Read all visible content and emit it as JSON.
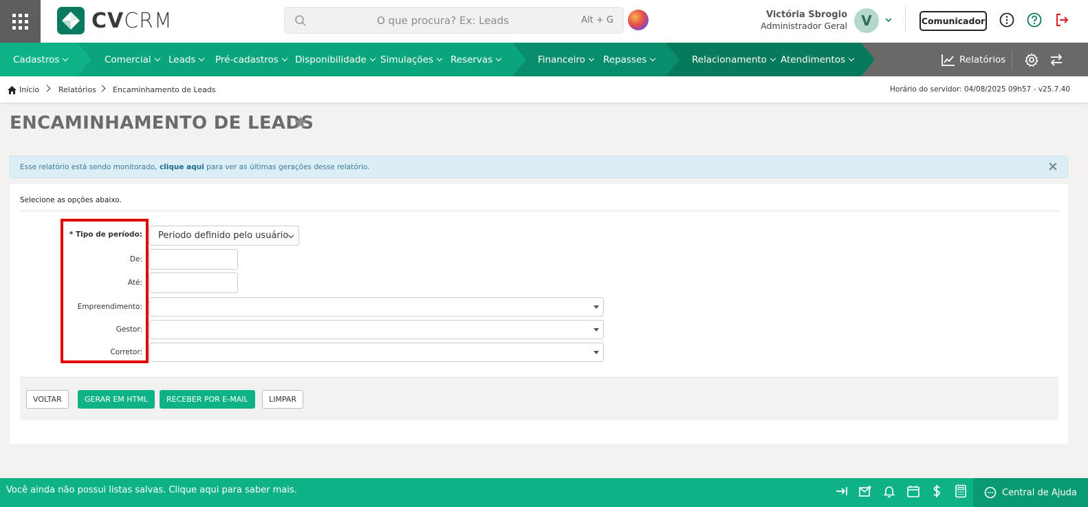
{
  "app": {
    "logo_text_bold": "CV",
    "logo_text_light": "CRM",
    "search_placeholder": "O que procura? Ex: Leads",
    "search_shortcut": "Alt + G"
  },
  "user": {
    "name": "Victória Sbrogio",
    "role": "Administrador Geral",
    "initial": "V"
  },
  "header": {
    "comunicador_label": "Comunicador"
  },
  "nav": {
    "items": [
      {
        "label": "Cadastros"
      },
      {
        "label": "Comercial"
      },
      {
        "label": "Leads"
      },
      {
        "label": "Pré-cadastros"
      },
      {
        "label": "Disponibilidade"
      },
      {
        "label": "Simulações"
      },
      {
        "label": "Reservas"
      },
      {
        "label": "Financeiro"
      },
      {
        "label": "Repasses"
      },
      {
        "label": "Relacionamento"
      },
      {
        "label": "Atendimentos"
      }
    ],
    "reports_label": "Relatórios"
  },
  "breadcrumb": {
    "home": "Início",
    "reports": "Relatórios",
    "current": "Encaminhamento de Leads",
    "server_time": "Horário do servidor: 04/08/2025 09h57 - v25.7.40"
  },
  "page": {
    "title": "ENCAMINHAMENTO DE LEADS"
  },
  "alert": {
    "text_before": "Esse relatório está sendo monitorado,",
    "link": "clique aqui",
    "text_after": "para ver as últimas gerações desse relatório."
  },
  "form": {
    "hint": "Selecione as opções abaixo.",
    "tipo_periodo_label": "* Tipo de período:",
    "tipo_periodo_value": "Periodo definido pelo usuário",
    "de_label": "De:",
    "ate_label": "Até:",
    "empreendimento_label": "Empreendimento:",
    "gestor_label": "Gestor:",
    "corretor_label": "Corretor:"
  },
  "actions": {
    "voltar": "VOLTAR",
    "gerar_html": "GERAR EM HTML",
    "receber_email": "RECEBER POR E-MAIL",
    "limpar": "LIMPAR"
  },
  "footer": {
    "text": "Você ainda não possui listas salvas. Clique aqui para saber mais.",
    "help_label": "Central de Ajuda"
  },
  "colors": {
    "green_primary": "#0db384",
    "green_dark": "#0a7a5e",
    "nav_gray": "#696969",
    "alert_bg": "#dcedf5",
    "highlight_red": "#e00000"
  }
}
